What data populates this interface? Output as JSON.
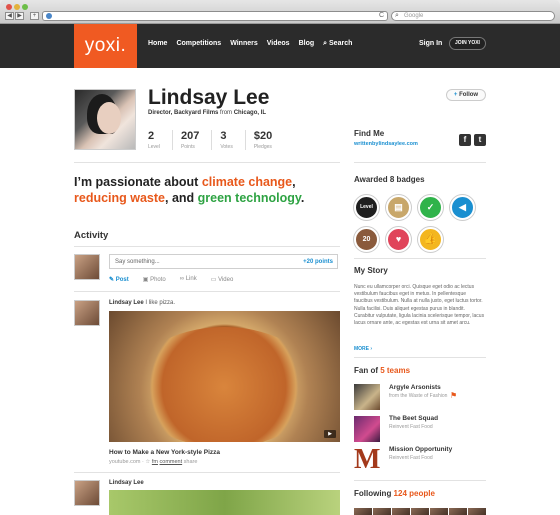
{
  "browser": {
    "search_placeholder": "Google",
    "back": "◀",
    "forward": "▶",
    "add_tab": "+",
    "reload": "C"
  },
  "header": {
    "logo": "yoxi.",
    "nav": [
      "Home",
      "Competitions",
      "Winners",
      "Videos",
      "Blog",
      "Search"
    ],
    "signin": "Sign In",
    "join": "JOIN YOXI"
  },
  "profile": {
    "name": "Lindsay Lee",
    "role": "Director, Backyard Films",
    "from_word": "from",
    "location": "Chicago, IL",
    "stats": [
      {
        "num": "2",
        "label": "Level"
      },
      {
        "num": "207",
        "label": "Points"
      },
      {
        "num": "3",
        "label": "Votes"
      },
      {
        "num": "$20",
        "label": "Pledges"
      }
    ],
    "follow": "Follow",
    "find_me": "Find Me",
    "find_link": "writtenbylindsaylee.com",
    "social": [
      "f",
      "t"
    ]
  },
  "statement": {
    "part1": "I’m passionate about ",
    "hl1": "climate change",
    "part2": ",",
    "hl2": "reducing waste",
    "part3": ", and ",
    "hl3": "green technology",
    "part4": "."
  },
  "activity": {
    "title": "Activity",
    "say_placeholder": "Say something...",
    "say_points": "+20 points",
    "tabs": [
      "Post",
      "Photo",
      "Link",
      "Video"
    ],
    "post1_author": "Lindsay Lee",
    "post1_text": "I like pizza.",
    "post1_title": "How to Make a New York-style Pizza",
    "post1_source": "youtube.com",
    "post1_actions": [
      "fm",
      "comment",
      "share"
    ],
    "post2_author": "Lindsay Lee"
  },
  "sidebar": {
    "badges_prefix": "Awarded ",
    "badges_count": "8",
    "badges_suffix": " badges",
    "badges": [
      {
        "icon": "level-badge-icon",
        "glyph": "Level",
        "color": "#1f1f1f"
      },
      {
        "icon": "clipboard-badge-icon",
        "glyph": "▤",
        "color": "#c8a76a"
      },
      {
        "icon": "check-badge-icon",
        "glyph": "✓",
        "color": "#2fb34a"
      },
      {
        "icon": "megaphone-badge-icon",
        "glyph": "◀",
        "color": "#1a8fd0"
      },
      {
        "icon": "antler-badge-icon",
        "glyph": "20",
        "color": "#8a5a3c"
      },
      {
        "icon": "heart-badge-icon",
        "glyph": "♥",
        "color": "#e0445a"
      },
      {
        "icon": "thumbs-up-badge-icon",
        "glyph": "👍",
        "color": "#f3b61f"
      }
    ],
    "story_title": "My Story",
    "story": "Nunc eu ullamcorper orci. Quisque eget odio ac lectus vestibulum faucibus eget in metus. In pellentesque faucibus vestibulum. Nulla at nulla justo, eget luctus tortor. Nulla facilisi. Duis aliquet egestas purus in blandit. Curabitur vulputate, ligula lacinia scelerisque tempor, lacus lacus ornare ante, ac egestas est urna sit amet arcu.",
    "more": "MORE ›",
    "fan_prefix": "Fan of ",
    "fan_count": "5 teams",
    "teams": [
      {
        "name": "Argyle Arsonists",
        "sub": "from the Waste of Fashion"
      },
      {
        "name": "The Beet Squad",
        "sub": "Reinvent Fast Food"
      },
      {
        "name": "Mission Opportunity",
        "sub": "Reinvent Fast Food"
      }
    ],
    "following_prefix": "Following ",
    "following_count": "124 people"
  }
}
